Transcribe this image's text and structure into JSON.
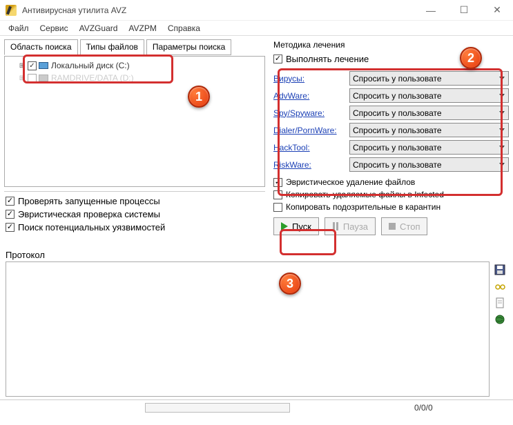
{
  "window": {
    "title": "Антивирусная утилита AVZ"
  },
  "menu": {
    "file": "Файл",
    "service": "Сервис",
    "avzguard": "AVZGuard",
    "avzpm": "AVZPM",
    "help": "Справка"
  },
  "tabs": {
    "scan_area": "Область поиска",
    "file_types": "Типы файлов",
    "scan_params": "Параметры поиска"
  },
  "tree": {
    "drive_c": "Локальный диск (C:)",
    "drive_other": "RAMDRIVE/DATA (D:)"
  },
  "left_checks": {
    "proc": "Проверять запущенные процессы",
    "heur": "Эвристическая проверка системы",
    "vuln": "Поиск потенциальных уязвимостей"
  },
  "right": {
    "method_label": "Методика лечения",
    "perform_cure": "Выполнять лечение",
    "threats": {
      "virus": "Вирусы:",
      "advware": "AdvWare:",
      "spy": "Spy/Spyware:",
      "dialer": "Dialer/PornWare:",
      "hacktool": "HackTool:",
      "riskware": "RiskWare:"
    },
    "combo_value": "Спросить у пользовате",
    "heur_del": "Эвристическое удаление файлов",
    "copy_infected": "Копировать удаляемые файлы в Infected",
    "copy_quarantine": "Копировать подозрительные в карантин"
  },
  "buttons": {
    "start": "Пуск",
    "pause": "Пауза",
    "stop": "Стоп"
  },
  "protocol": {
    "label": "Протокол"
  },
  "status": {
    "counts": "0/0/0"
  },
  "annotations": {
    "n1": "1",
    "n2": "2",
    "n3": "3"
  }
}
